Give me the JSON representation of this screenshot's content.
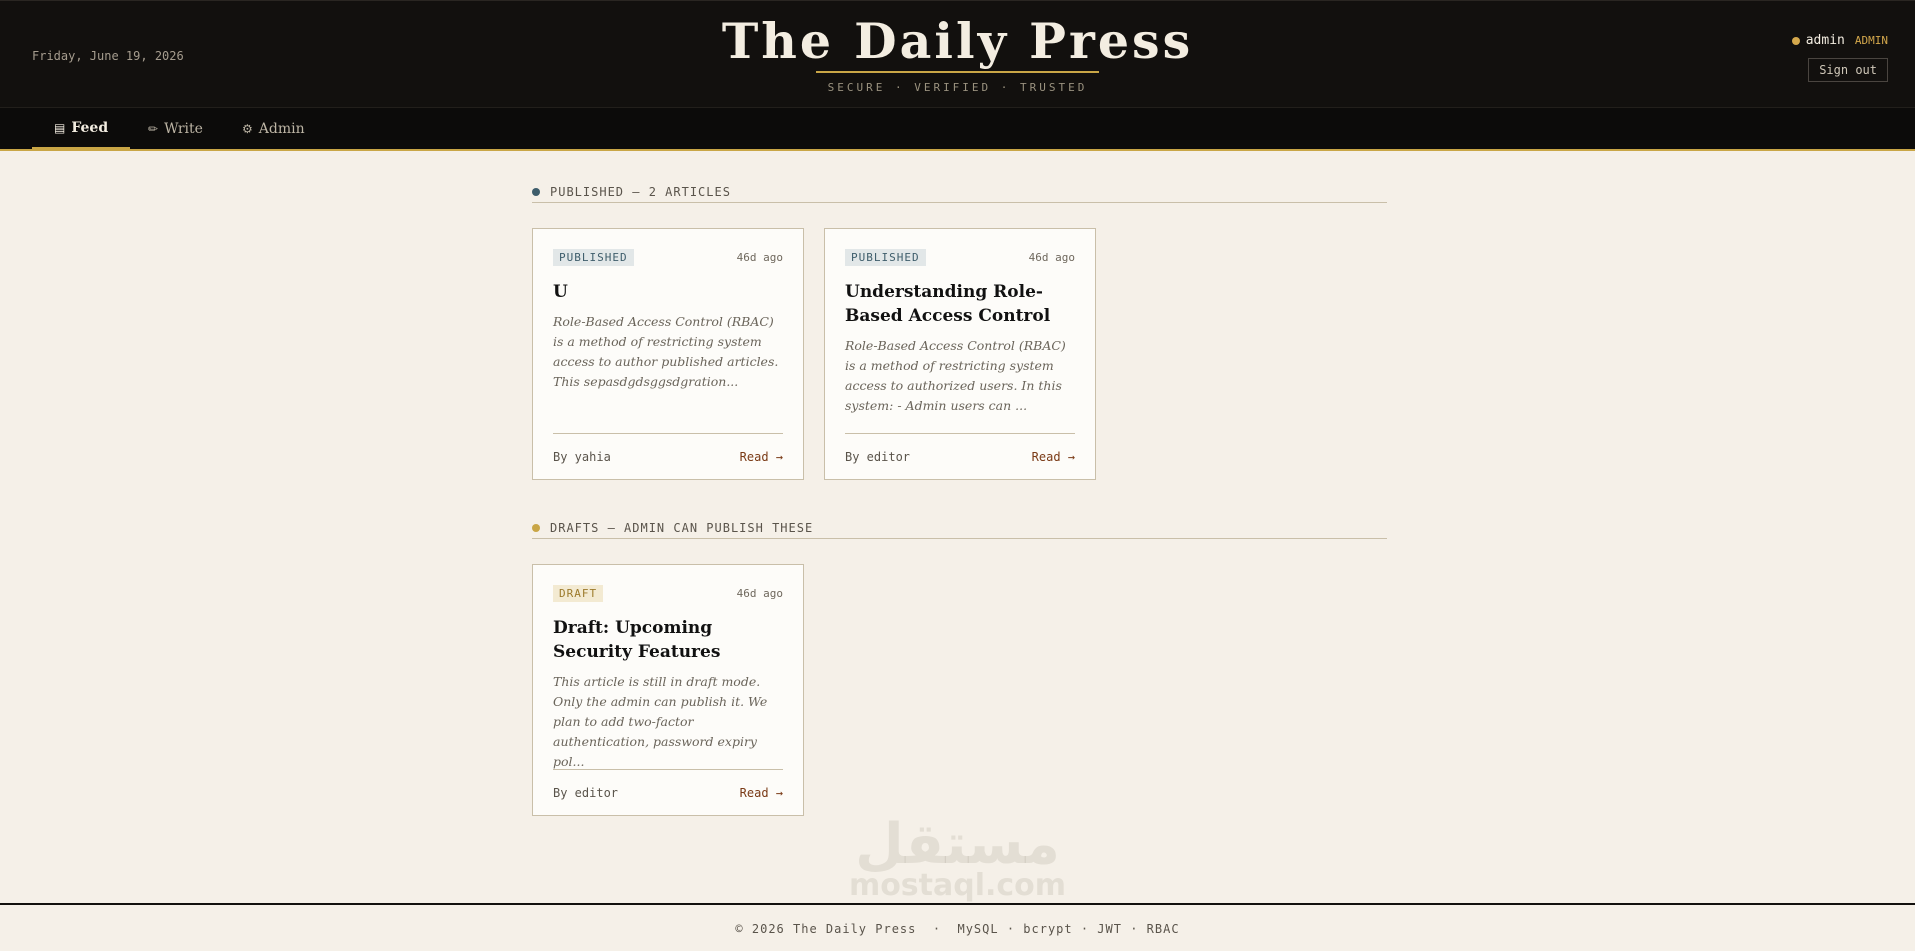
{
  "header": {
    "date": "Friday, June 19, 2026",
    "title": "The Daily Press",
    "tagline": "SECURE · VERIFIED · TRUSTED",
    "user": {
      "name": "admin",
      "role": "ADMIN",
      "signout_label": "Sign out"
    }
  },
  "nav": {
    "items": [
      {
        "icon": "newspaper-icon",
        "glyph": "▤",
        "label": "Feed",
        "active": true
      },
      {
        "icon": "pen-icon",
        "glyph": "✏",
        "label": "Write",
        "active": false
      },
      {
        "icon": "gear-icon",
        "glyph": "⚙",
        "label": "Admin",
        "active": false
      }
    ]
  },
  "sections": {
    "published": {
      "heading": "PUBLISHED — 2 ARTICLES",
      "dot_color": "#3e5d6b",
      "articles": [
        {
          "badge": "PUBLISHED",
          "ago": "46d ago",
          "title": "U",
          "excerpt": "Role-Based Access Control (RBAC) is a method of restricting system access to author published articles. This sepasdgdsggsdgration...",
          "byline": "By yahia",
          "read": "Read →"
        },
        {
          "badge": "PUBLISHED",
          "ago": "46d ago",
          "title": "Understanding Role-Based Access Control",
          "excerpt": "Role-Based Access Control (RBAC) is a method of restricting system access to authorized users. In this system: - Admin users can ...",
          "byline": "By editor",
          "read": "Read →"
        }
      ]
    },
    "drafts": {
      "heading": "DRAFTS — ADMIN CAN PUBLISH THESE",
      "dot_color": "#c9a646",
      "articles": [
        {
          "badge": "DRAFT",
          "ago": "46d ago",
          "title": "Draft: Upcoming Security Features",
          "excerpt": "This article is still in draft mode. Only the admin can publish it. We plan to add two-factor authentication, password expiry pol...",
          "byline": "By editor",
          "read": "Read →"
        }
      ]
    }
  },
  "footer": {
    "text": "© 2026 The Daily Press  ·  MySQL · bcrypt · JWT · RBAC"
  },
  "watermark": {
    "arabic": "مستقل",
    "latin": "mostaql.com"
  },
  "colors": {
    "accent": "#c9a646",
    "header_bg": "#12100e",
    "page_bg": "#f5f0e8",
    "link": "#7a3a16"
  }
}
